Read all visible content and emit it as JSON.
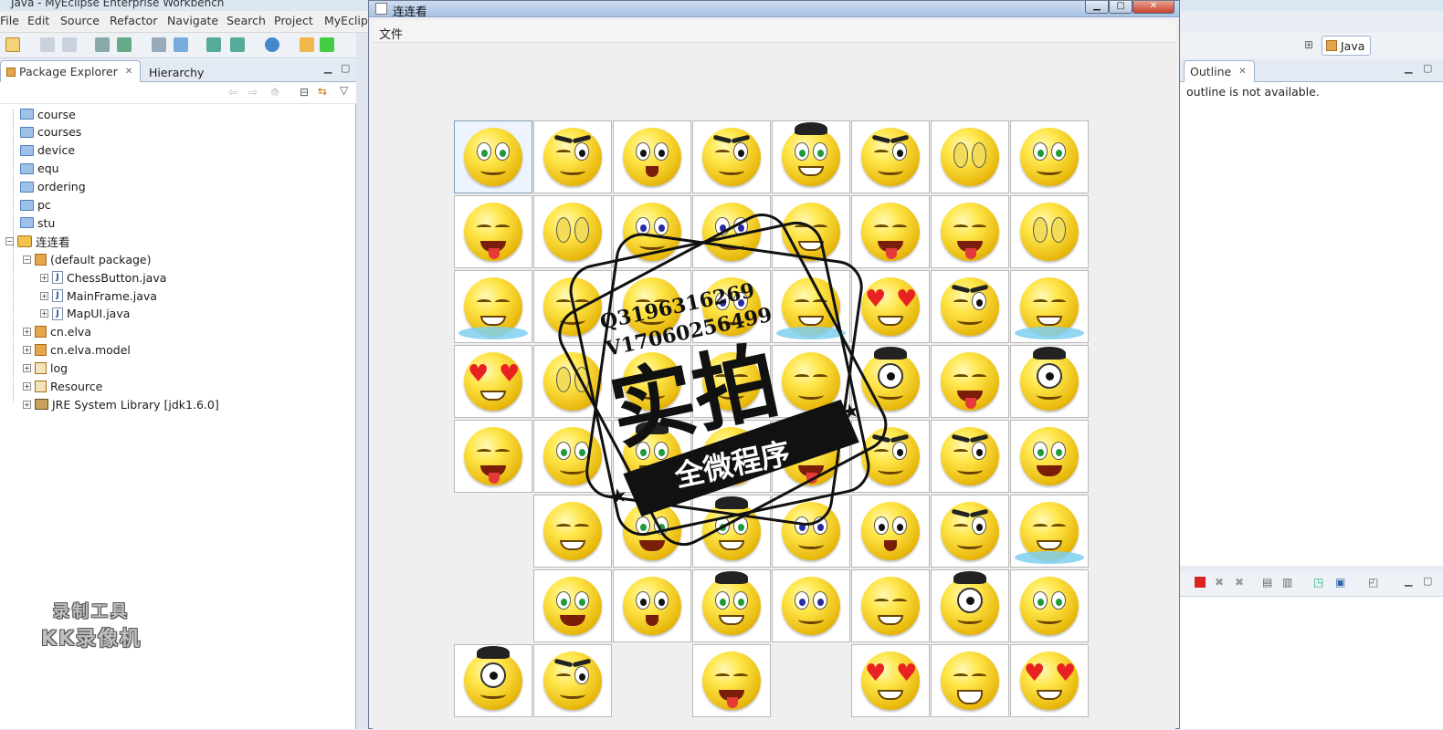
{
  "ide": {
    "title": "Java - MyEclipse Enterprise Workbench",
    "menu": [
      "File",
      "Edit",
      "Source",
      "Refactor",
      "Navigate",
      "Search",
      "Project",
      "MyEclip"
    ],
    "perspective": "Java"
  },
  "package_explorer": {
    "tabs": [
      "Package Explorer",
      "Hierarchy"
    ],
    "tree": [
      {
        "label": "course",
        "type": "folder"
      },
      {
        "label": "courses",
        "type": "folder"
      },
      {
        "label": "device",
        "type": "folder"
      },
      {
        "label": "equ",
        "type": "folder"
      },
      {
        "label": "ordering",
        "type": "folder"
      },
      {
        "label": "pc",
        "type": "folder"
      },
      {
        "label": "stu",
        "type": "folder"
      },
      {
        "label": "连连看",
        "type": "project"
      },
      {
        "label": "(default package)",
        "type": "package"
      },
      {
        "label": "ChessButton.java",
        "type": "java"
      },
      {
        "label": "MainFrame.java",
        "type": "java"
      },
      {
        "label": "MapUI.java",
        "type": "java"
      },
      {
        "label": "cn.elva",
        "type": "package"
      },
      {
        "label": "cn.elva.model",
        "type": "package"
      },
      {
        "label": "log",
        "type": "source"
      },
      {
        "label": "Resource",
        "type": "source"
      },
      {
        "label": "JRE System Library [jdk1.6.0]",
        "type": "library"
      }
    ]
  },
  "outline": {
    "tab": "Outline",
    "message": "outline is not available."
  },
  "recorder_watermark": {
    "line1": "录制工具",
    "line2": "KK录像机"
  },
  "game_window": {
    "title": "连连看",
    "menu": "文件",
    "grid": [
      [
        "green",
        "wink",
        "surprised",
        "wink",
        "nerd",
        "wink",
        "eyes-closed",
        "green"
      ],
      [
        "tongue",
        "eyes-closed",
        "blue",
        "blue",
        "happy",
        "tongue",
        "tongue",
        "eyes-closed"
      ],
      [
        "cry",
        "smile",
        "smile",
        "blue",
        "cry",
        "hearts",
        "wink",
        "cry"
      ],
      [
        "hearts",
        "eyes-closed",
        "smile",
        "smile",
        "smile",
        "cyclops",
        "tongue",
        "cyclops"
      ],
      [
        "tongue",
        "green",
        "nerd",
        "tongue",
        "tongue",
        "wink",
        "wink",
        "laugh"
      ],
      [
        "",
        "happy",
        "laugh",
        "nerd",
        "blue",
        "surprised",
        "wink",
        "cry"
      ],
      [
        "",
        "laugh",
        "surprised",
        "nerd",
        "blue",
        "happy",
        "cyclops",
        "green"
      ],
      [
        "cyclops",
        "wink",
        "",
        "tongue",
        "",
        "hearts",
        "teeth",
        "hearts"
      ]
    ]
  },
  "stamp": {
    "qq": "Q3196316269",
    "wechat": "V17060256499",
    "big": "实拍",
    "banner": "全微程序"
  }
}
